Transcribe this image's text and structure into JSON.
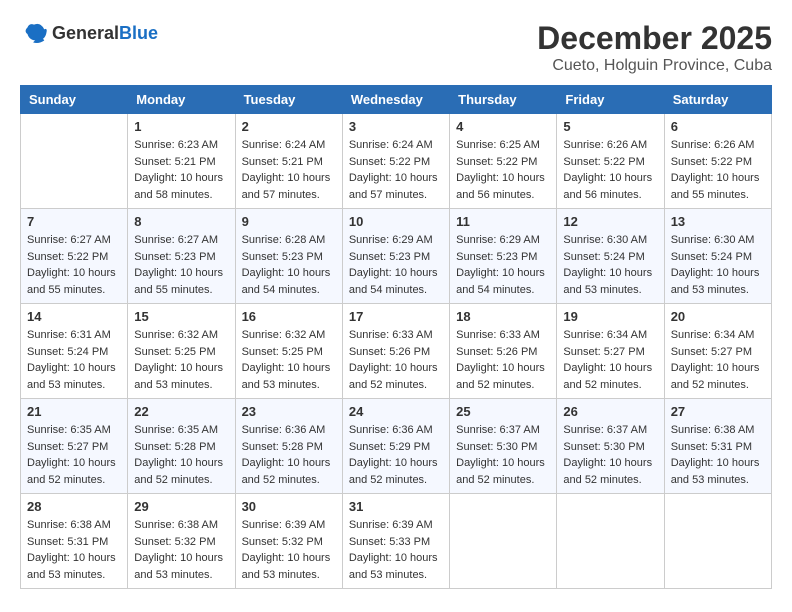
{
  "logo": {
    "general": "General",
    "blue": "Blue"
  },
  "header": {
    "month": "December 2025",
    "location": "Cueto, Holguin Province, Cuba"
  },
  "weekdays": [
    "Sunday",
    "Monday",
    "Tuesday",
    "Wednesday",
    "Thursday",
    "Friday",
    "Saturday"
  ],
  "weeks": [
    [
      {
        "day": "",
        "info": ""
      },
      {
        "day": "1",
        "sunrise": "Sunrise: 6:23 AM",
        "sunset": "Sunset: 5:21 PM",
        "daylight": "Daylight: 10 hours and 58 minutes."
      },
      {
        "day": "2",
        "sunrise": "Sunrise: 6:24 AM",
        "sunset": "Sunset: 5:21 PM",
        "daylight": "Daylight: 10 hours and 57 minutes."
      },
      {
        "day": "3",
        "sunrise": "Sunrise: 6:24 AM",
        "sunset": "Sunset: 5:22 PM",
        "daylight": "Daylight: 10 hours and 57 minutes."
      },
      {
        "day": "4",
        "sunrise": "Sunrise: 6:25 AM",
        "sunset": "Sunset: 5:22 PM",
        "daylight": "Daylight: 10 hours and 56 minutes."
      },
      {
        "day": "5",
        "sunrise": "Sunrise: 6:26 AM",
        "sunset": "Sunset: 5:22 PM",
        "daylight": "Daylight: 10 hours and 56 minutes."
      },
      {
        "day": "6",
        "sunrise": "Sunrise: 6:26 AM",
        "sunset": "Sunset: 5:22 PM",
        "daylight": "Daylight: 10 hours and 55 minutes."
      }
    ],
    [
      {
        "day": "7",
        "sunrise": "Sunrise: 6:27 AM",
        "sunset": "Sunset: 5:22 PM",
        "daylight": "Daylight: 10 hours and 55 minutes."
      },
      {
        "day": "8",
        "sunrise": "Sunrise: 6:27 AM",
        "sunset": "Sunset: 5:23 PM",
        "daylight": "Daylight: 10 hours and 55 minutes."
      },
      {
        "day": "9",
        "sunrise": "Sunrise: 6:28 AM",
        "sunset": "Sunset: 5:23 PM",
        "daylight": "Daylight: 10 hours and 54 minutes."
      },
      {
        "day": "10",
        "sunrise": "Sunrise: 6:29 AM",
        "sunset": "Sunset: 5:23 PM",
        "daylight": "Daylight: 10 hours and 54 minutes."
      },
      {
        "day": "11",
        "sunrise": "Sunrise: 6:29 AM",
        "sunset": "Sunset: 5:23 PM",
        "daylight": "Daylight: 10 hours and 54 minutes."
      },
      {
        "day": "12",
        "sunrise": "Sunrise: 6:30 AM",
        "sunset": "Sunset: 5:24 PM",
        "daylight": "Daylight: 10 hours and 53 minutes."
      },
      {
        "day": "13",
        "sunrise": "Sunrise: 6:30 AM",
        "sunset": "Sunset: 5:24 PM",
        "daylight": "Daylight: 10 hours and 53 minutes."
      }
    ],
    [
      {
        "day": "14",
        "sunrise": "Sunrise: 6:31 AM",
        "sunset": "Sunset: 5:24 PM",
        "daylight": "Daylight: 10 hours and 53 minutes."
      },
      {
        "day": "15",
        "sunrise": "Sunrise: 6:32 AM",
        "sunset": "Sunset: 5:25 PM",
        "daylight": "Daylight: 10 hours and 53 minutes."
      },
      {
        "day": "16",
        "sunrise": "Sunrise: 6:32 AM",
        "sunset": "Sunset: 5:25 PM",
        "daylight": "Daylight: 10 hours and 53 minutes."
      },
      {
        "day": "17",
        "sunrise": "Sunrise: 6:33 AM",
        "sunset": "Sunset: 5:26 PM",
        "daylight": "Daylight: 10 hours and 52 minutes."
      },
      {
        "day": "18",
        "sunrise": "Sunrise: 6:33 AM",
        "sunset": "Sunset: 5:26 PM",
        "daylight": "Daylight: 10 hours and 52 minutes."
      },
      {
        "day": "19",
        "sunrise": "Sunrise: 6:34 AM",
        "sunset": "Sunset: 5:27 PM",
        "daylight": "Daylight: 10 hours and 52 minutes."
      },
      {
        "day": "20",
        "sunrise": "Sunrise: 6:34 AM",
        "sunset": "Sunset: 5:27 PM",
        "daylight": "Daylight: 10 hours and 52 minutes."
      }
    ],
    [
      {
        "day": "21",
        "sunrise": "Sunrise: 6:35 AM",
        "sunset": "Sunset: 5:27 PM",
        "daylight": "Daylight: 10 hours and 52 minutes."
      },
      {
        "day": "22",
        "sunrise": "Sunrise: 6:35 AM",
        "sunset": "Sunset: 5:28 PM",
        "daylight": "Daylight: 10 hours and 52 minutes."
      },
      {
        "day": "23",
        "sunrise": "Sunrise: 6:36 AM",
        "sunset": "Sunset: 5:28 PM",
        "daylight": "Daylight: 10 hours and 52 minutes."
      },
      {
        "day": "24",
        "sunrise": "Sunrise: 6:36 AM",
        "sunset": "Sunset: 5:29 PM",
        "daylight": "Daylight: 10 hours and 52 minutes."
      },
      {
        "day": "25",
        "sunrise": "Sunrise: 6:37 AM",
        "sunset": "Sunset: 5:30 PM",
        "daylight": "Daylight: 10 hours and 52 minutes."
      },
      {
        "day": "26",
        "sunrise": "Sunrise: 6:37 AM",
        "sunset": "Sunset: 5:30 PM",
        "daylight": "Daylight: 10 hours and 52 minutes."
      },
      {
        "day": "27",
        "sunrise": "Sunrise: 6:38 AM",
        "sunset": "Sunset: 5:31 PM",
        "daylight": "Daylight: 10 hours and 53 minutes."
      }
    ],
    [
      {
        "day": "28",
        "sunrise": "Sunrise: 6:38 AM",
        "sunset": "Sunset: 5:31 PM",
        "daylight": "Daylight: 10 hours and 53 minutes."
      },
      {
        "day": "29",
        "sunrise": "Sunrise: 6:38 AM",
        "sunset": "Sunset: 5:32 PM",
        "daylight": "Daylight: 10 hours and 53 minutes."
      },
      {
        "day": "30",
        "sunrise": "Sunrise: 6:39 AM",
        "sunset": "Sunset: 5:32 PM",
        "daylight": "Daylight: 10 hours and 53 minutes."
      },
      {
        "day": "31",
        "sunrise": "Sunrise: 6:39 AM",
        "sunset": "Sunset: 5:33 PM",
        "daylight": "Daylight: 10 hours and 53 minutes."
      },
      {
        "day": "",
        "info": ""
      },
      {
        "day": "",
        "info": ""
      },
      {
        "day": "",
        "info": ""
      }
    ]
  ]
}
